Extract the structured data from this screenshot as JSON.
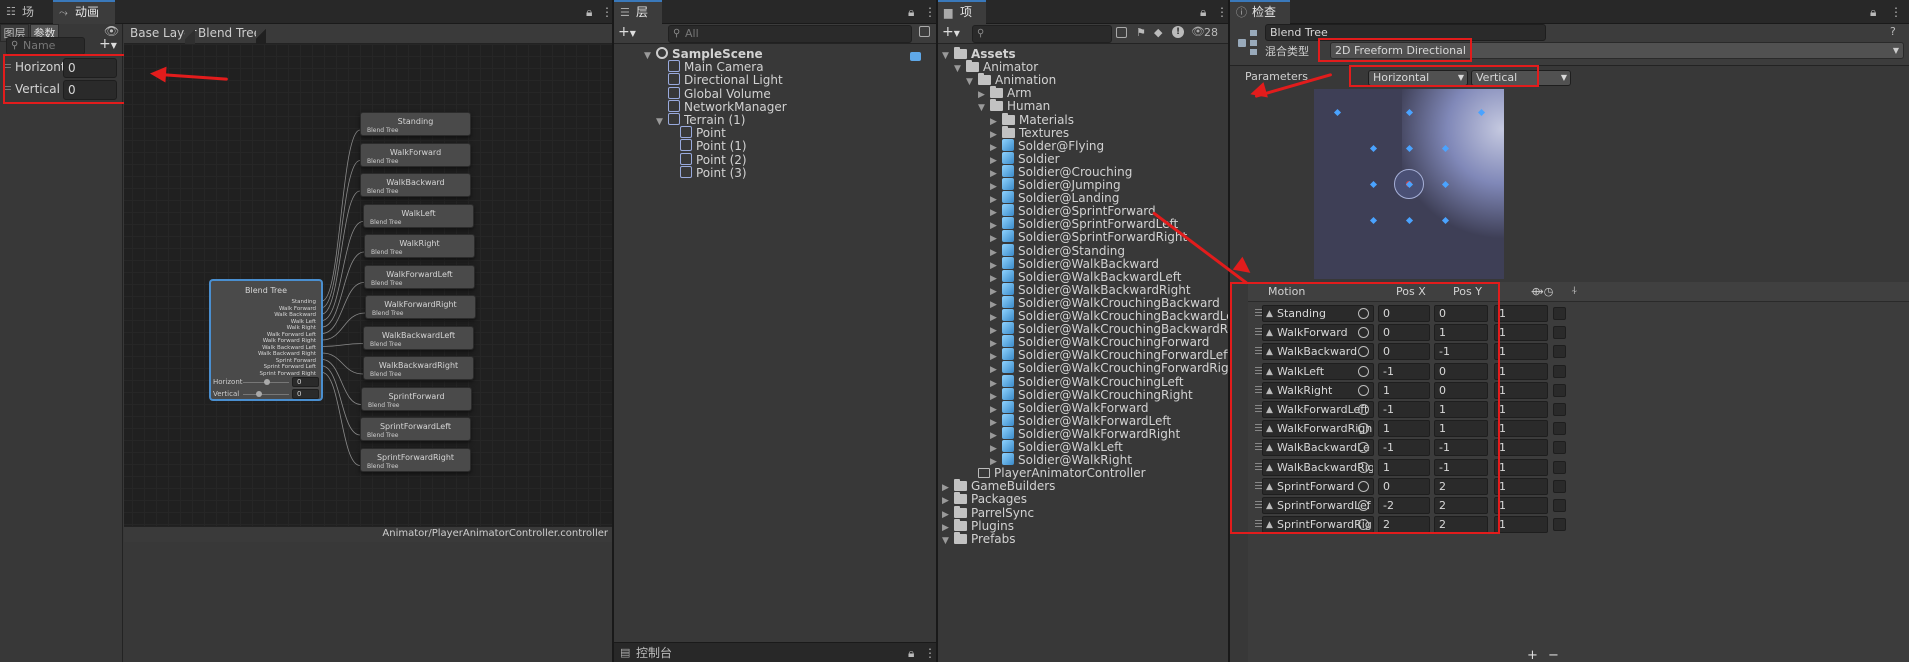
{
  "animator": {
    "tab_scene": "场景",
    "tab_animator": "动画器",
    "subtab_layers": "图层",
    "subtab_params": "参数",
    "search_placeholder": "Name",
    "params": [
      {
        "name": "Horizontal",
        "value": "0"
      },
      {
        "name": "Vertical",
        "value": "0"
      }
    ],
    "breadcrumb": [
      "Base Layer",
      "Blend Tree"
    ],
    "footer_path": "Animator/PlayerAnimatorController.controller",
    "blend_node": {
      "title": "Blend Tree",
      "inputs": [
        "Standing",
        "Walk Forward",
        "Walk Backward",
        "Walk Left",
        "Walk Right",
        "Walk Forward Left",
        "Walk Forward Right",
        "Walk Backward Left",
        "Walk Backward Right",
        "Sprint Forward",
        "Sprint Forward Left",
        "Sprint Forward Right"
      ],
      "param_rows": [
        {
          "name": "Horizont",
          "value": "0"
        },
        {
          "name": "Vertical",
          "value": "0"
        }
      ]
    },
    "child_nodes": [
      "Standing",
      "WalkForward",
      "WalkBackward",
      "WalkLeft",
      "WalkRight",
      "WalkForwardLeft",
      "WalkForwardRight",
      "WalkBackwardLeft",
      "WalkBackwardRight",
      "SprintForward",
      "SprintForwardLeft",
      "SprintForwardRight"
    ],
    "child_sublabel": "Blend Tree"
  },
  "hierarchy": {
    "tab": "层级",
    "search_placeholder": "All",
    "items": [
      {
        "label": "SampleScene",
        "depth": 0,
        "kind": "scene",
        "bold": true
      },
      {
        "label": "Main Camera",
        "depth": 1,
        "kind": "go"
      },
      {
        "label": "Directional Light",
        "depth": 1,
        "kind": "go"
      },
      {
        "label": "Global Volume",
        "depth": 1,
        "kind": "go"
      },
      {
        "label": "NetworkManager",
        "depth": 1,
        "kind": "go"
      },
      {
        "label": "Terrain (1)",
        "depth": 1,
        "kind": "go",
        "expanded": true
      },
      {
        "label": "Point",
        "depth": 2,
        "kind": "go"
      },
      {
        "label": "Point (1)",
        "depth": 2,
        "kind": "go"
      },
      {
        "label": "Point (2)",
        "depth": 2,
        "kind": "go"
      },
      {
        "label": "Point (3)",
        "depth": 2,
        "kind": "go"
      }
    ]
  },
  "project": {
    "tab": "项目",
    "count": "28",
    "items": [
      {
        "label": "Assets",
        "depth": 0,
        "kind": "folder",
        "exp": "open",
        "bold": true
      },
      {
        "label": "Animator",
        "depth": 1,
        "kind": "folder",
        "exp": "open"
      },
      {
        "label": "Animation",
        "depth": 2,
        "kind": "folder",
        "exp": "open"
      },
      {
        "label": "Arm",
        "depth": 3,
        "kind": "folder",
        "exp": "closed"
      },
      {
        "label": "Human",
        "depth": 3,
        "kind": "folder",
        "exp": "open"
      },
      {
        "label": "Materials",
        "depth": 4,
        "kind": "folder",
        "exp": "closed"
      },
      {
        "label": "Textures",
        "depth": 4,
        "kind": "folder",
        "exp": "closed"
      },
      {
        "label": "Solder@Flying",
        "depth": 4,
        "kind": "model",
        "exp": "closed"
      },
      {
        "label": "Soldier",
        "depth": 4,
        "kind": "model",
        "exp": "closed"
      },
      {
        "label": "Soldier@Crouching",
        "depth": 4,
        "kind": "model",
        "exp": "closed"
      },
      {
        "label": "Soldier@Jumping",
        "depth": 4,
        "kind": "model",
        "exp": "closed"
      },
      {
        "label": "Soldier@Landing",
        "depth": 4,
        "kind": "model",
        "exp": "closed"
      },
      {
        "label": "Soldier@SprintForward",
        "depth": 4,
        "kind": "model",
        "exp": "closed"
      },
      {
        "label": "Soldier@SprintForwardLeft",
        "depth": 4,
        "kind": "model",
        "exp": "closed"
      },
      {
        "label": "Soldier@SprintForwardRight",
        "depth": 4,
        "kind": "model",
        "exp": "closed"
      },
      {
        "label": "Soldier@Standing",
        "depth": 4,
        "kind": "model",
        "exp": "closed"
      },
      {
        "label": "Soldier@WalkBackward",
        "depth": 4,
        "kind": "model",
        "exp": "closed"
      },
      {
        "label": "Soldier@WalkBackwardLeft",
        "depth": 4,
        "kind": "model",
        "exp": "closed"
      },
      {
        "label": "Soldier@WalkBackwardRight",
        "depth": 4,
        "kind": "model",
        "exp": "closed"
      },
      {
        "label": "Soldier@WalkCrouchingBackward",
        "depth": 4,
        "kind": "model",
        "exp": "closed"
      },
      {
        "label": "Soldier@WalkCrouchingBackwardLeft",
        "depth": 4,
        "kind": "model",
        "exp": "closed"
      },
      {
        "label": "Soldier@WalkCrouchingBackwardRight",
        "depth": 4,
        "kind": "model",
        "exp": "closed"
      },
      {
        "label": "Soldier@WalkCrouchingForward",
        "depth": 4,
        "kind": "model",
        "exp": "closed"
      },
      {
        "label": "Soldier@WalkCrouchingForwardLeft",
        "depth": 4,
        "kind": "model",
        "exp": "closed"
      },
      {
        "label": "Soldier@WalkCrouchingForwardRight",
        "depth": 4,
        "kind": "model",
        "exp": "closed"
      },
      {
        "label": "Soldier@WalkCrouchingLeft",
        "depth": 4,
        "kind": "model",
        "exp": "closed"
      },
      {
        "label": "Soldier@WalkCrouchingRight",
        "depth": 4,
        "kind": "model",
        "exp": "closed"
      },
      {
        "label": "Soldier@WalkForward",
        "depth": 4,
        "kind": "model",
        "exp": "closed"
      },
      {
        "label": "Soldier@WalkForwardLeft",
        "depth": 4,
        "kind": "model",
        "exp": "closed"
      },
      {
        "label": "Soldier@WalkForwardRight",
        "depth": 4,
        "kind": "model",
        "exp": "closed"
      },
      {
        "label": "Soldier@WalkLeft",
        "depth": 4,
        "kind": "model",
        "exp": "closed"
      },
      {
        "label": "Soldier@WalkRight",
        "depth": 4,
        "kind": "model",
        "exp": "closed"
      },
      {
        "label": "PlayerAnimatorController",
        "depth": 2,
        "kind": "controller",
        "exp": "none"
      },
      {
        "label": "GameBuilders",
        "depth": 0,
        "kind": "folder",
        "exp": "closed"
      },
      {
        "label": "Packages",
        "depth": 0,
        "kind": "folder",
        "exp": "closed"
      },
      {
        "label": "ParrelSync",
        "depth": 0,
        "kind": "folder",
        "exp": "closed"
      },
      {
        "label": "Plugins",
        "depth": 0,
        "kind": "folder",
        "exp": "closed"
      },
      {
        "label": "Prefabs",
        "depth": 0,
        "kind": "folder",
        "exp": "open"
      }
    ]
  },
  "console": {
    "tab": "控制台"
  },
  "inspector": {
    "tab": "检查器",
    "object_name": "Blend Tree",
    "blend_type_label": "混合类型",
    "blend_type_value": "2D Freeform Directional",
    "parameters_label": "Parameters",
    "param_x": "Horizontal",
    "param_y": "Vertical",
    "motion_header": "Motion",
    "posx_header": "Pos X",
    "posy_header": "Pos Y",
    "motions": [
      {
        "name": "Standing",
        "x": "0",
        "y": "0"
      },
      {
        "name": "WalkForward",
        "x": "0",
        "y": "1"
      },
      {
        "name": "WalkBackward",
        "x": "0",
        "y": "-1"
      },
      {
        "name": "WalkLeft",
        "x": "-1",
        "y": "0"
      },
      {
        "name": "WalkRight",
        "x": "1",
        "y": "0"
      },
      {
        "name": "WalkForwardLeft",
        "x": "-1",
        "y": "1"
      },
      {
        "name": "WalkForwardRigh",
        "x": "1",
        "y": "1"
      },
      {
        "name": "WalkBackwardLe",
        "x": "-1",
        "y": "-1"
      },
      {
        "name": "WalkBackwardRig",
        "x": "1",
        "y": "-1"
      },
      {
        "name": "SprintForward",
        "x": "0",
        "y": "2"
      },
      {
        "name": "SprintForwardLef",
        "x": "-2",
        "y": "2"
      },
      {
        "name": "SprintForwardRig",
        "x": "2",
        "y": "2"
      }
    ],
    "speed_col": "1"
  },
  "colors": {
    "accent": "#3a79bb",
    "annotation": "#e21c1c",
    "node_selected": "#4a8fd0"
  }
}
